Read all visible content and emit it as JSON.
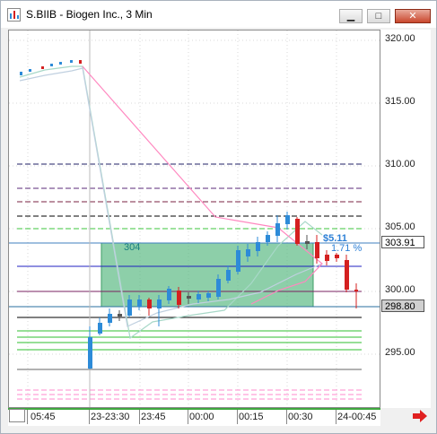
{
  "window": {
    "title": "S.BIIB - Biogen Inc., 3 Min",
    "minimize_glyph": "▁",
    "maximize_glyph": "□",
    "close_glyph": "✕"
  },
  "y_axis": {
    "ticks": [
      "320.00",
      "315.00",
      "310.00",
      "305.00",
      "300.00",
      "295.00"
    ],
    "last_price": "303.91",
    "crosshair_price": "298.80"
  },
  "x_axis": {
    "ticks": [
      "05:45",
      "23-23:30",
      "23:45",
      "00:00",
      "00:15",
      "00:30",
      "24-00:45"
    ]
  },
  "annotations": {
    "zone_label": "304",
    "target_amount": "$5.11",
    "target_percent": "1.71 %"
  },
  "colors": {
    "up_candle": "#2d8bd8",
    "down_candle": "#d42020",
    "zone_fill": "#5dbb85",
    "scroll_arrow": "#e02020",
    "axis_rule": "#3ea83e"
  },
  "icons": {
    "app": "chart-icon",
    "scroll": "arrow-right-icon"
  }
}
